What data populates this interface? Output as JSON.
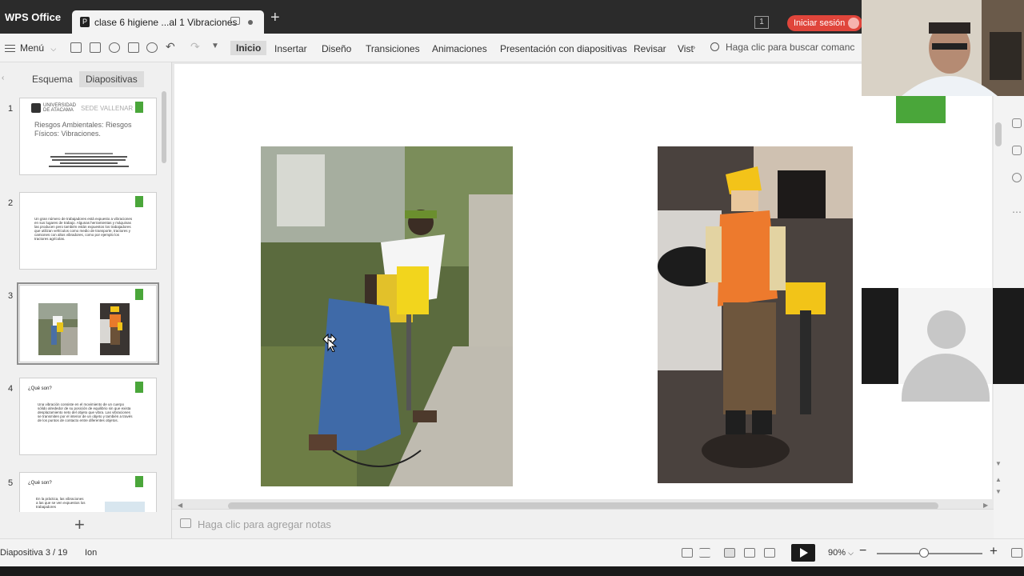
{
  "titlebar": {
    "app_name": "WPS Office",
    "document_tab": "clase 6 higiene ...al 1 Vibraciones",
    "window_count": "1",
    "signin_label": "Iniciar sesión"
  },
  "ribbon": {
    "menu_label": "Menú",
    "tabs": [
      "Inicio",
      "Insertar",
      "Diseño",
      "Transiciones",
      "Animaciones",
      "Presentación con diapositivas",
      "Revisar",
      "Vist"
    ],
    "active_tab": "Inicio",
    "search_placeholder": "Haga clic para buscar comanc"
  },
  "left_panel": {
    "tabs": [
      "Esquema",
      "Diapositivas"
    ],
    "active_tab": "Diapositivas",
    "slides": [
      {
        "number": "1",
        "university": "UNIVERSIDAD DE ATACAMA",
        "campus": "SEDE VALLENAR",
        "title": "Riesgos Ambientales: Riesgos Físicos: Vibraciones."
      },
      {
        "number": "2",
        "text": "Un gran número de trabajadores está expuesto a vibraciones en sus lugares de trabajo. Algunas herramientas y máquinas las producen pero también están expuestos los trabajadores que utilizan vehículos como medio de transporte, tractores y camiones con altos vibradores, como por ejemplo los tractores agrícolas."
      },
      {
        "number": "3"
      },
      {
        "number": "4",
        "heading": "¿Qué son?",
        "text": "Una vibración consiste en el movimiento de un cuerpo sólido alrededor de su posición de equilibrio sin que exista desplazamiento neto del objeto que vibra. Las vibraciones se transmiten por el interior de un objeto y también a través de los puntos de contacto entre diferentes objetos."
      },
      {
        "number": "5",
        "heading": "¿Qué son?",
        "text": "En la práctica, las vibraciones a las que se ven expuestos los trabajadores"
      }
    ],
    "selected_slide": "3"
  },
  "notes": {
    "placeholder": "Haga clic para agregar notas"
  },
  "statusbar": {
    "slide_indicator": "Diapositiva 3 / 19",
    "theme": "Ion",
    "zoom": "90%",
    "zoom_minus": "−",
    "zoom_plus": "+",
    "zoom_level": 0.45
  },
  "colors": {
    "accent_green": "#4aa63a",
    "signin_red": "#e0453b",
    "titlebar": "#2b2b2b"
  },
  "icons": {
    "new_tab": "+",
    "add_slide": "+"
  }
}
